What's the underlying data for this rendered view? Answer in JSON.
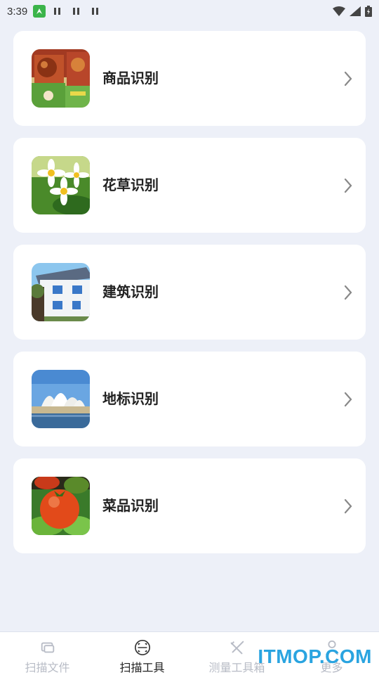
{
  "status_bar": {
    "time": "3:39"
  },
  "cards": [
    {
      "label": "商品识别",
      "icon": "product-photo"
    },
    {
      "label": "花草识别",
      "icon": "flower-photo"
    },
    {
      "label": "建筑识别",
      "icon": "building-photo"
    },
    {
      "label": "地标识别",
      "icon": "landmark-photo"
    },
    {
      "label": "菜品识别",
      "icon": "dish-photo"
    }
  ],
  "bottom_nav": {
    "items": [
      {
        "label": "扫描文件",
        "icon": "files-icon",
        "active": false
      },
      {
        "label": "扫描工具",
        "icon": "scan-icon",
        "active": true
      },
      {
        "label": "测量工具箱",
        "icon": "ruler-icon",
        "active": false
      },
      {
        "label": "更多",
        "icon": "user-icon",
        "active": false
      }
    ]
  },
  "watermark": "ITMOP.COM",
  "colors": {
    "background": "#edf0f8",
    "card": "#ffffff",
    "active_text": "#222222",
    "inactive_text": "#b8bcc6",
    "watermark": "#2aa4e0"
  }
}
